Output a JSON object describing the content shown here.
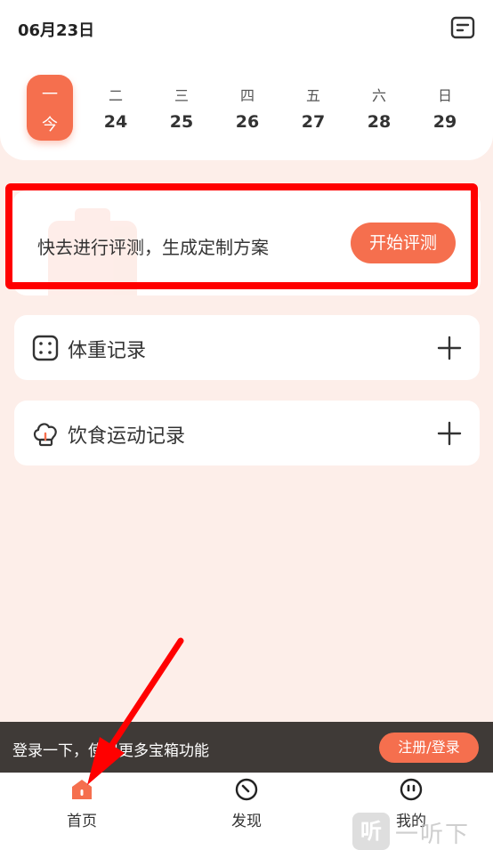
{
  "header": {
    "date": "06月23日",
    "calendar_icon": "calendar-icon"
  },
  "week": [
    {
      "weekday": "一",
      "date": "今",
      "active": true
    },
    {
      "weekday": "二",
      "date": "24",
      "active": false
    },
    {
      "weekday": "三",
      "date": "25",
      "active": false
    },
    {
      "weekday": "四",
      "date": "26",
      "active": false
    },
    {
      "weekday": "五",
      "date": "27",
      "active": false
    },
    {
      "weekday": "六",
      "date": "28",
      "active": false
    },
    {
      "weekday": "日",
      "date": "29",
      "active": false
    }
  ],
  "assessment": {
    "text": "快去进行评测，生成定制方案",
    "button_label": "开始评测"
  },
  "records": [
    {
      "label": "体重记录",
      "icon": "scale-icon"
    },
    {
      "label": "饮食运动记录",
      "icon": "chef-hat-icon"
    }
  ],
  "login_bar": {
    "text": "登录一下，使用更多宝箱功能",
    "button_label": "注册/登录"
  },
  "tabs": [
    {
      "label": "首页",
      "icon": "home-icon",
      "active": true
    },
    {
      "label": "发现",
      "icon": "compass-icon",
      "active": false
    },
    {
      "label": "我的",
      "icon": "face-icon",
      "active": false
    }
  ],
  "watermark": {
    "logo": "听",
    "text": "一听下载"
  },
  "colors": {
    "accent": "#f56f4e",
    "background": "#fdeee9",
    "login_bar": "#3f3a37",
    "annotation": "#ff0000"
  }
}
